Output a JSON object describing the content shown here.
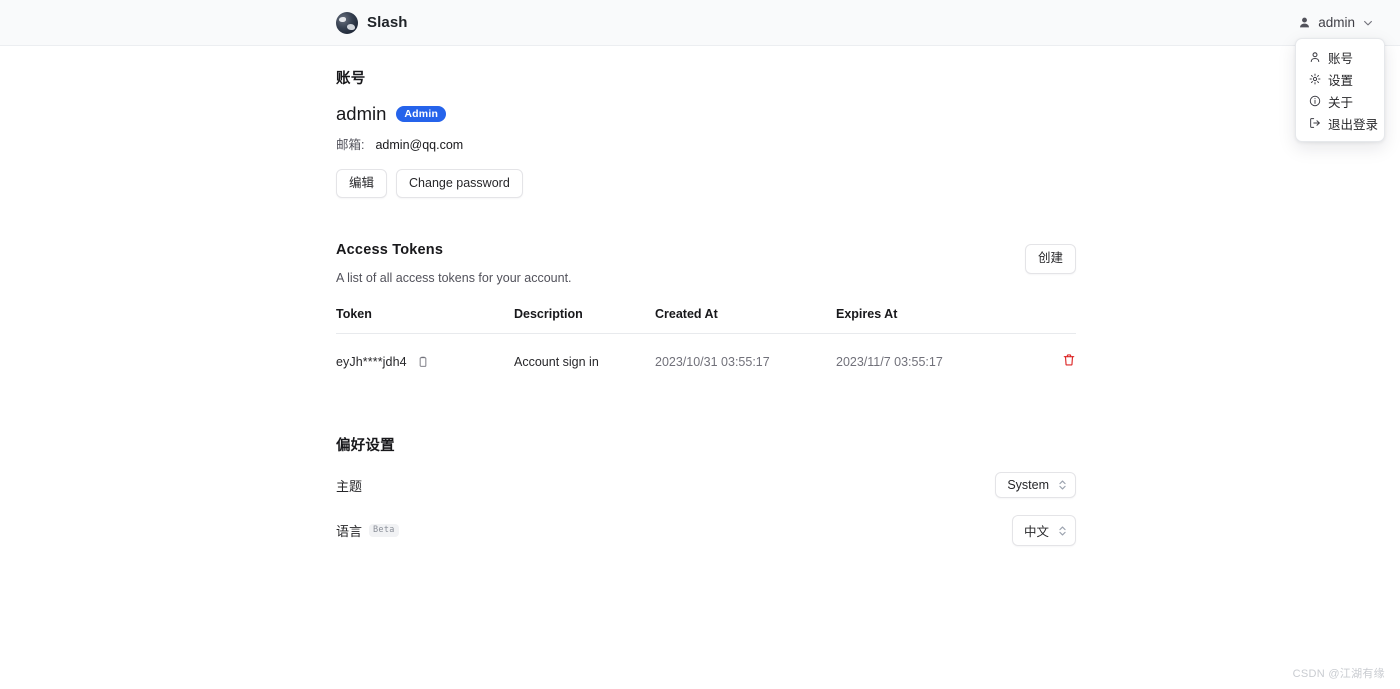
{
  "header": {
    "brand_name": "Slash",
    "brand_logo_icon": "globe-logo-icon",
    "user_name": "admin",
    "user_icon": "person-icon",
    "chevron_icon": "chevron-down-icon"
  },
  "user_menu": {
    "items": [
      {
        "label": "账号",
        "icon": "person-icon"
      },
      {
        "label": "设置",
        "icon": "gear-icon"
      },
      {
        "label": "关于",
        "icon": "info-circle-icon"
      },
      {
        "label": "退出登录",
        "icon": "logout-icon"
      }
    ]
  },
  "account": {
    "section_title": "账号",
    "user_name": "admin",
    "role_badge": "Admin",
    "email_label": "邮箱:",
    "email_value": "admin@qq.com",
    "edit_button": "编辑",
    "change_password_button": "Change password"
  },
  "tokens": {
    "section_title": "Access Tokens",
    "description": "A list of all access tokens for your account.",
    "create_button": "创建",
    "columns": [
      "Token",
      "Description",
      "Created At",
      "Expires At"
    ],
    "rows": [
      {
        "token": "eyJh****jdh4",
        "description": "Account sign in",
        "created_at": "2023/10/31 03:55:17",
        "expires_at": "2023/11/7 03:55:17",
        "copy_icon": "copy-icon",
        "delete_icon": "trash-icon"
      }
    ]
  },
  "preferences": {
    "section_title": "偏好设置",
    "theme": {
      "label": "主题",
      "value": "System"
    },
    "language": {
      "label": "语言",
      "badge": "Beta",
      "value": "中文"
    }
  },
  "watermark": "CSDN @江湖有缘",
  "colors": {
    "accent": "#2563eb",
    "danger": "#dc2626",
    "header_bg": "#f9fafb",
    "muted_text": "#71717a"
  }
}
